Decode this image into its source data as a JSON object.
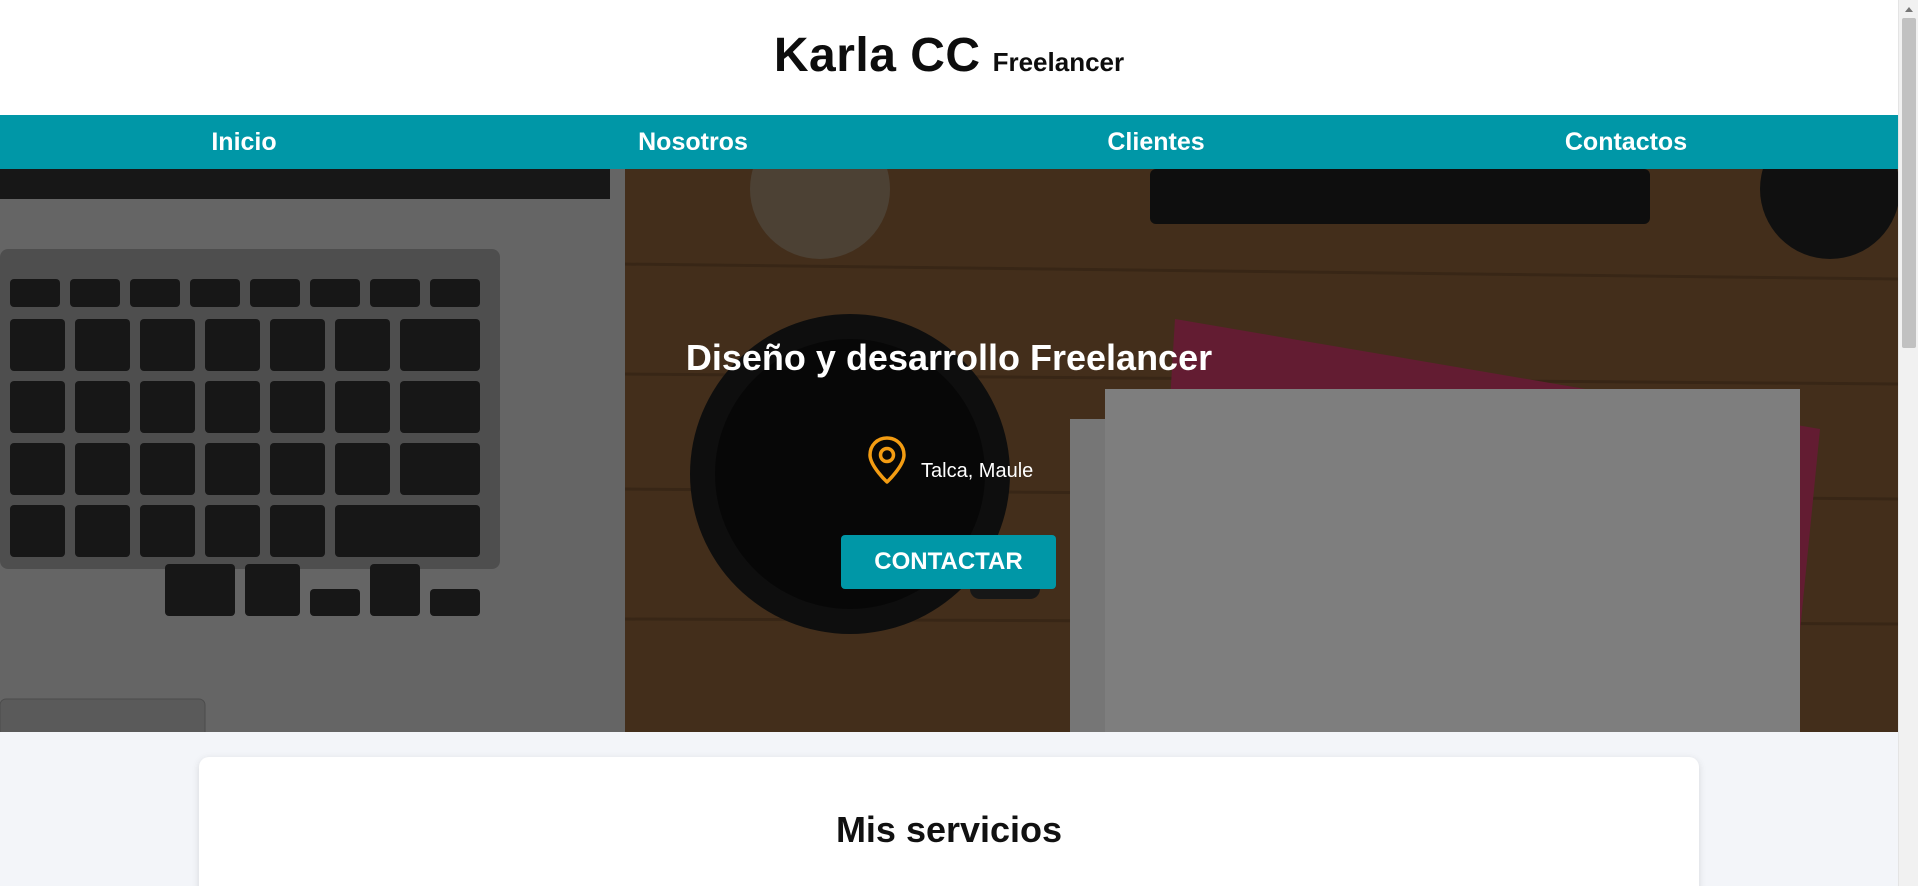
{
  "header": {
    "brand_name": "Karla CC",
    "brand_tag": "Freelancer"
  },
  "nav": {
    "items": [
      {
        "label": "Inicio"
      },
      {
        "label": "Nosotros"
      },
      {
        "label": "Clientes"
      },
      {
        "label": "Contactos"
      }
    ]
  },
  "hero": {
    "title": "Diseño y desarrollo Freelancer",
    "location": "Talca, Maule",
    "location_icon": "map-pin-icon",
    "cta_label": "CONTACTAR"
  },
  "services": {
    "title": "Mis servicios"
  },
  "colors": {
    "accent": "#0097a7",
    "pin": "#f39c12",
    "header_bg": "#ffffff",
    "page_bg": "#f3f5f9"
  }
}
